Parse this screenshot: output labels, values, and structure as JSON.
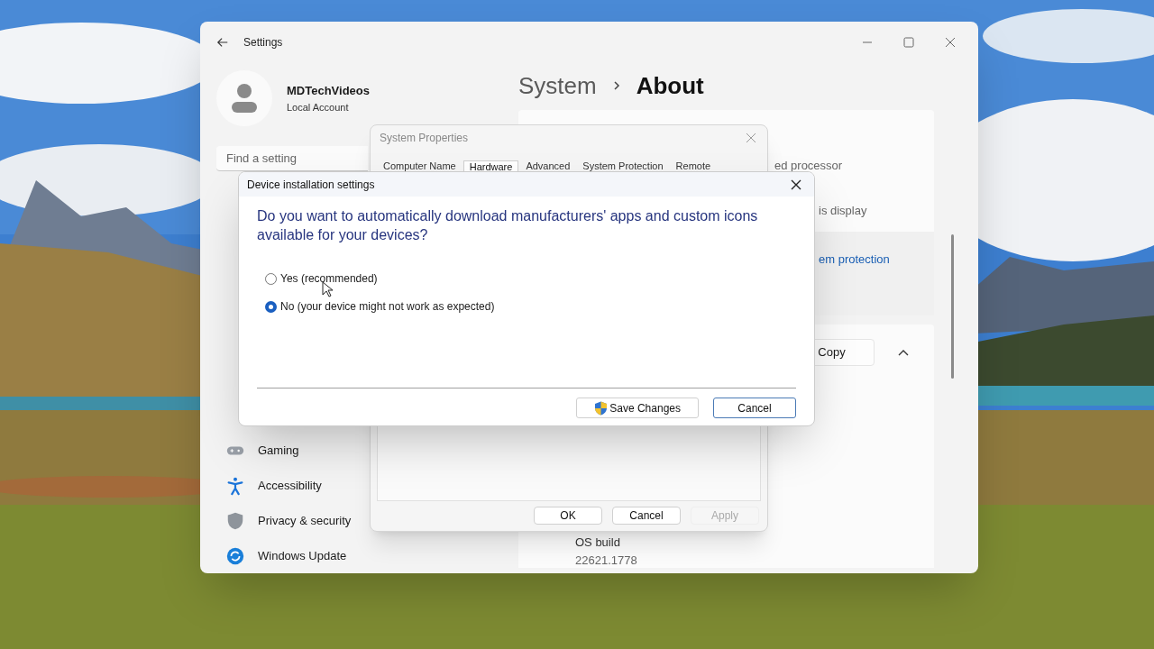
{
  "settings_window": {
    "title": "Settings",
    "account": {
      "name": "MDTechVideos",
      "type": "Local Account"
    },
    "search": {
      "placeholder": "Find a setting"
    },
    "sidebar": {
      "items": [
        {
          "label": "Gaming"
        },
        {
          "label": "Accessibility"
        },
        {
          "label": "Privacy & security"
        },
        {
          "label": "Windows Update"
        }
      ]
    },
    "breadcrumb": {
      "parent": "System",
      "current": "About"
    },
    "spec_rows": [
      "ed processor",
      "is display"
    ],
    "related_link": "em protection",
    "copy_button": "Copy",
    "os_build": {
      "label": "OS build",
      "value": "22621.1778"
    }
  },
  "system_properties": {
    "title": "System Properties",
    "tabs": [
      {
        "label": "Computer Name",
        "selected": false
      },
      {
        "label": "Hardware",
        "selected": true
      },
      {
        "label": "Advanced",
        "selected": false
      },
      {
        "label": "System Protection",
        "selected": false
      },
      {
        "label": "Remote",
        "selected": false
      }
    ],
    "buttons": [
      {
        "label": "OK",
        "disabled": false
      },
      {
        "label": "Cancel",
        "disabled": false
      },
      {
        "label": "Apply",
        "disabled": true
      }
    ]
  },
  "device_dialog": {
    "title": "Device installation settings",
    "question": "Do you want to automatically download manufacturers' apps and custom icons available for your devices?",
    "options": [
      {
        "label": "Yes (recommended)",
        "selected": false
      },
      {
        "label": "No (your device might not work as expected)",
        "selected": true
      }
    ],
    "buttons": [
      {
        "label": "Save Changes",
        "shield": true,
        "focused": false
      },
      {
        "label": "Cancel",
        "shield": false,
        "focused": true
      }
    ]
  }
}
